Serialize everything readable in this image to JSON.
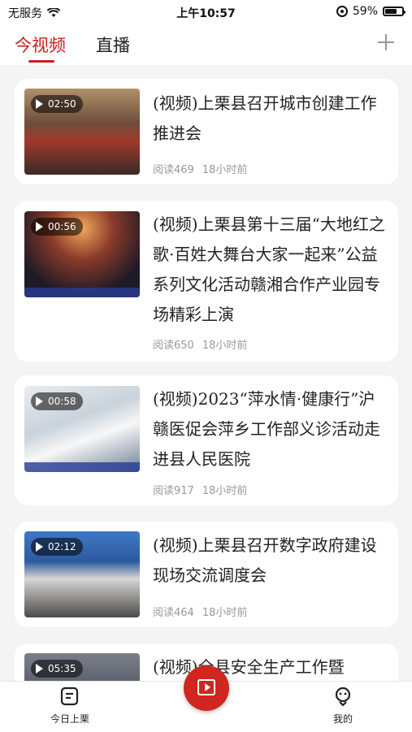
{
  "status_bar": {
    "carrier": "无服务",
    "time": "上午10:57",
    "battery": "59%"
  },
  "tabs": [
    {
      "label": "今视频",
      "active": true
    },
    {
      "label": "直播",
      "active": false
    }
  ],
  "accent_color": "#c81e1e",
  "videos": [
    {
      "duration": "02:50",
      "title": "(视频)上栗县召开城市创建工作推进会",
      "reads": "阅读469",
      "time": "18小时前"
    },
    {
      "duration": "00:56",
      "title": "(视频)上栗县第十三届“大地红之歌·百姓大舞台大家一起来”公益系列文化活动赣湘合作产业园专场精彩上演",
      "reads": "阅读650",
      "time": "18小时前"
    },
    {
      "duration": "00:58",
      "title": "(视频)2023“萍水情·健康行”沪赣医促会萍乡工作部义诊活动走进县人民医院",
      "reads": "阅读917",
      "time": "18小时前"
    },
    {
      "duration": "02:12",
      "title": "(视频)上栗县召开数字政府建设现场交流调度会",
      "reads": "阅读464",
      "time": "18小时前"
    },
    {
      "duration": "05:35",
      "title": "(视频)全县安全生产工作暨",
      "reads": "",
      "time": ""
    }
  ],
  "bottom_nav": {
    "left_label": "今日上栗",
    "right_label": "我的",
    "left_icon": "news-icon",
    "center_icon": "video-play-icon",
    "right_icon": "profile-icon"
  }
}
